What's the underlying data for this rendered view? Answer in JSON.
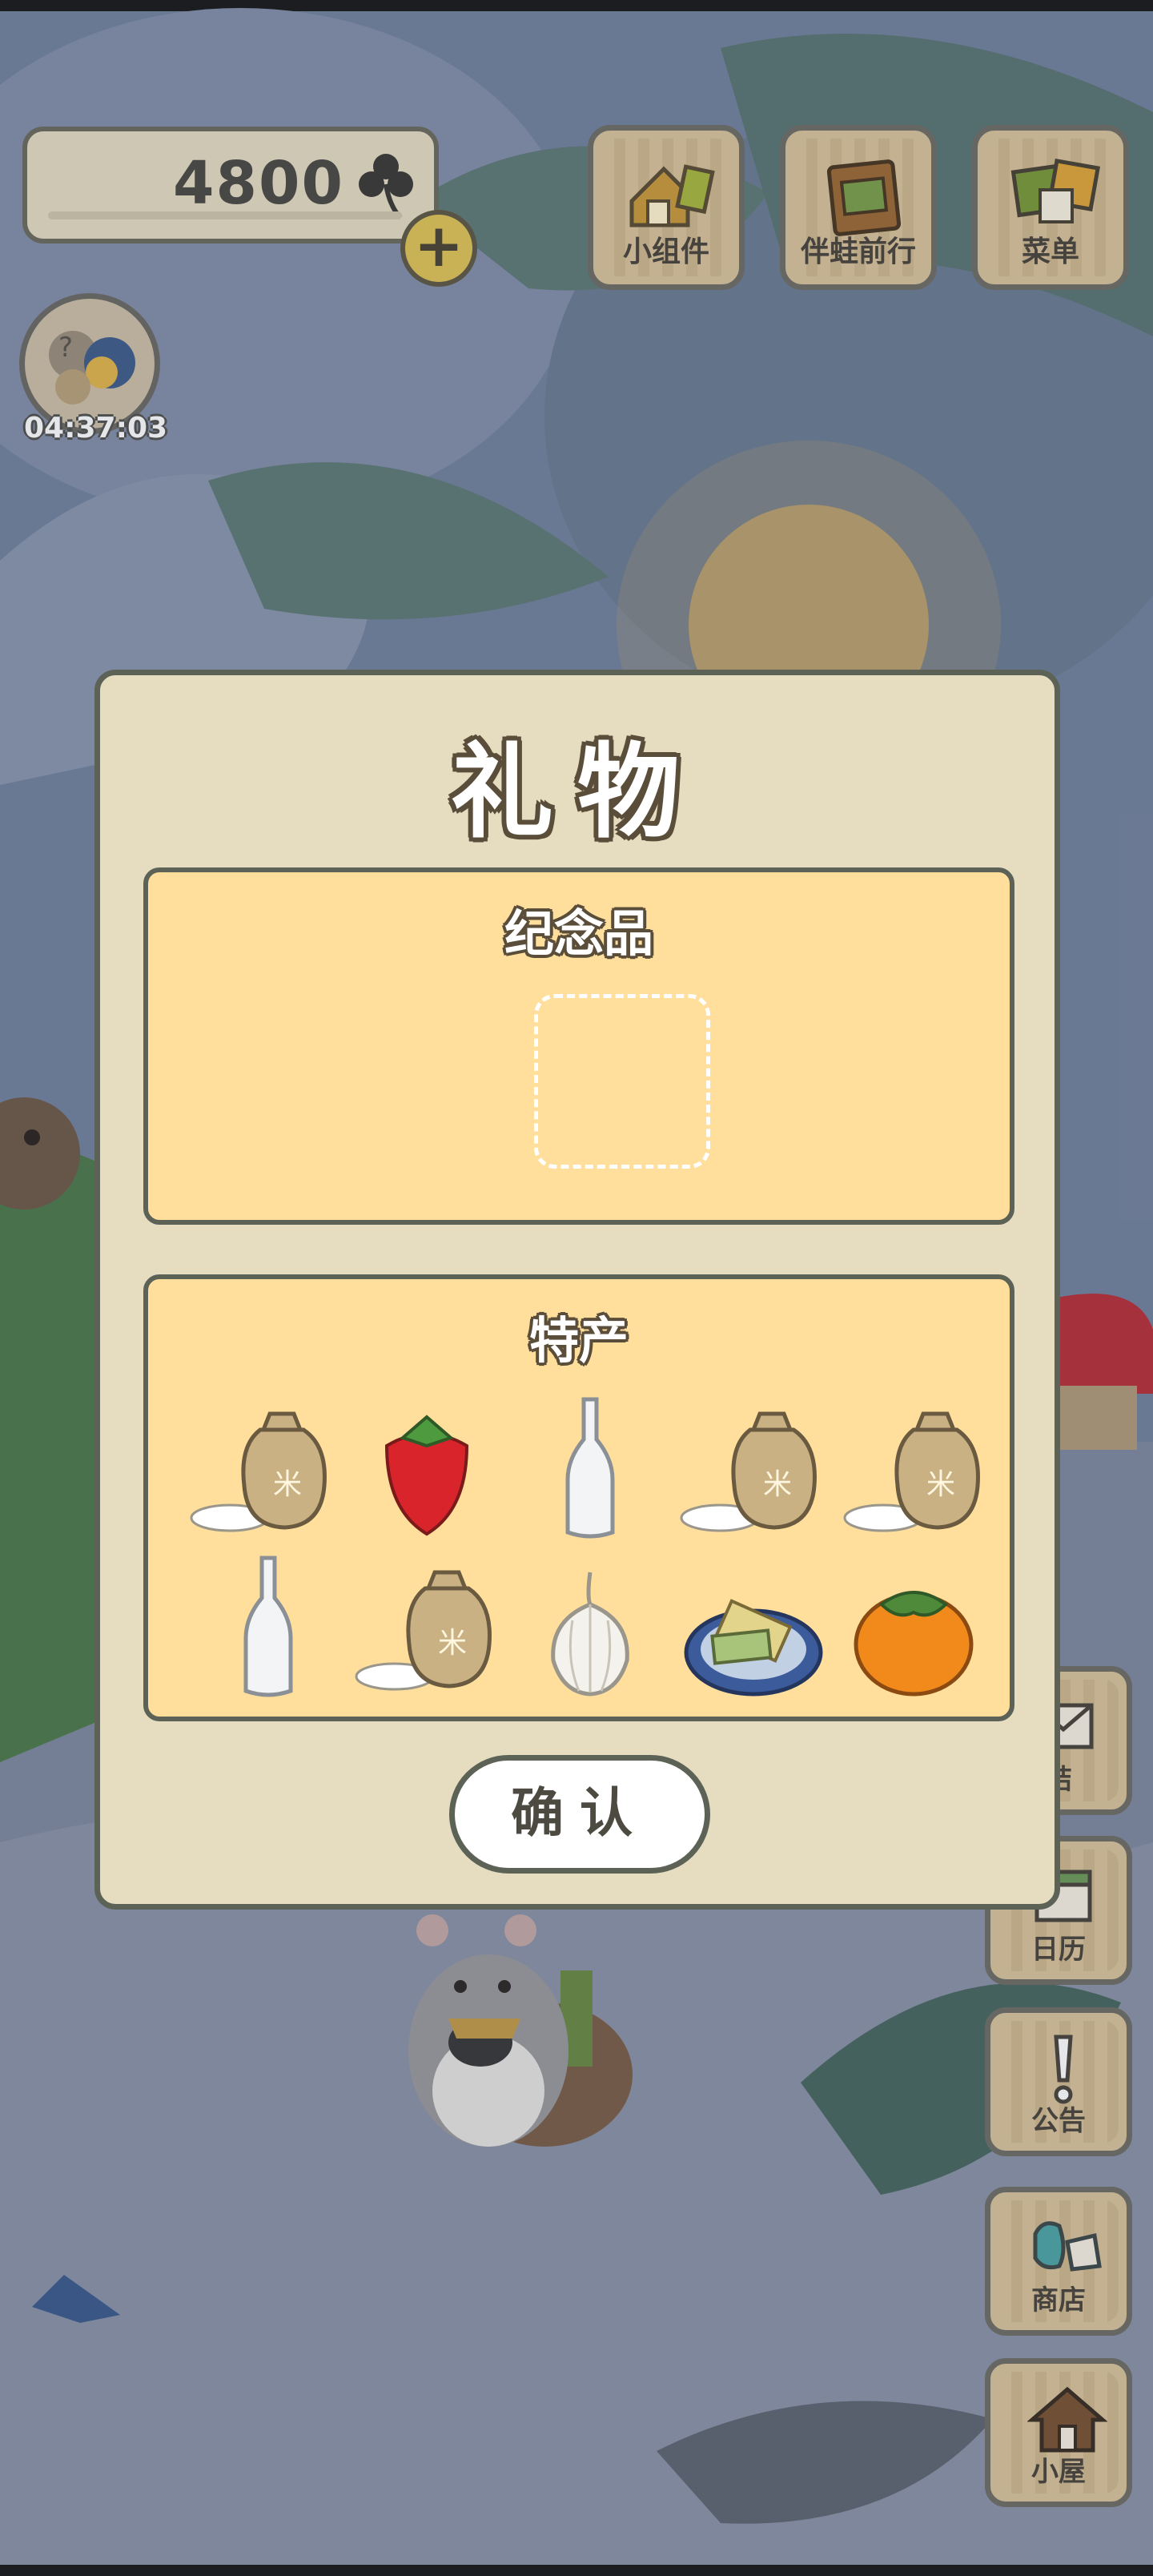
{
  "hud": {
    "clover_count": "4800",
    "timer": "04:37:03",
    "plus_label": "+"
  },
  "top_buttons": [
    {
      "label": "小组件",
      "icon": "widget-icon"
    },
    {
      "label": "伴蛙前行",
      "icon": "journal-icon"
    },
    {
      "label": "菜单",
      "icon": "menu-cards-icon"
    }
  ],
  "side_buttons": [
    {
      "label": "结",
      "icon": "letter-icon"
    },
    {
      "label": "日历",
      "icon": "calendar-icon"
    },
    {
      "label": "公告",
      "icon": "exclamation-icon"
    },
    {
      "label": "商店",
      "icon": "bag-icon"
    },
    {
      "label": "小屋",
      "icon": "house-icon"
    }
  ],
  "gift_dialog": {
    "title": "礼物",
    "souvenir_title": "纪念品",
    "specialty_title": "特产",
    "confirm_label": "确认",
    "specialty_items": [
      "rice-bag-icon",
      "strawberry-icon",
      "glass-bottle-icon",
      "rice-bag-icon",
      "rice-bag-icon",
      "glass-bottle-icon",
      "rice-bag-icon",
      "garlic-icon",
      "popsicle-plate-icon",
      "persimmon-icon"
    ]
  },
  "colors": {
    "panel_yellow": "#ffdf9b",
    "modal_bg": "#e6ddc1",
    "outline": "#5d6257"
  }
}
